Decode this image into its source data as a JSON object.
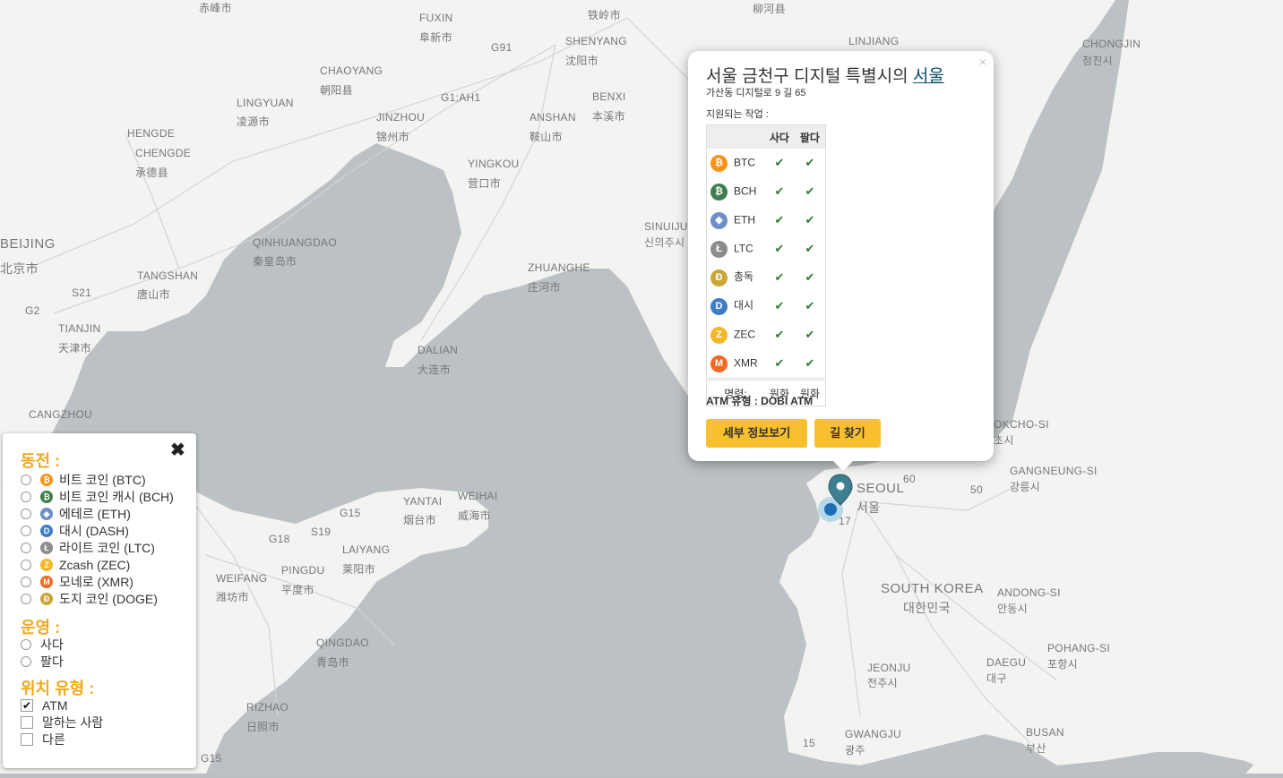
{
  "map": {
    "labels": [
      {
        "text": "赤峰市"
      },
      {
        "text": "FUXIN"
      },
      {
        "text": "阜新市"
      },
      {
        "text": "铁岭市"
      },
      {
        "text": "柳河县"
      },
      {
        "text": "G91"
      },
      {
        "text": "SHENYANG"
      },
      {
        "text": "沈阳市"
      },
      {
        "text": "LINJIANG"
      },
      {
        "text": "CHONGJIN"
      },
      {
        "text": "청진시"
      },
      {
        "text": "CHAOYANG"
      },
      {
        "text": "朝阳县"
      },
      {
        "text": "G1;AH1"
      },
      {
        "text": "BENXI"
      },
      {
        "text": "本溪市"
      },
      {
        "text": "LINGYUAN"
      },
      {
        "text": "凌源市"
      },
      {
        "text": "JINZHOU"
      },
      {
        "text": "锦州市"
      },
      {
        "text": "ANSHAN"
      },
      {
        "text": "鞍山市"
      },
      {
        "text": "HENGDE"
      },
      {
        "text": "CHENGDE"
      },
      {
        "text": "承德县"
      },
      {
        "text": "YINGKOU"
      },
      {
        "text": "营口市"
      },
      {
        "text": "SINUIJU"
      },
      {
        "text": "신의주시"
      },
      {
        "text": "BEIJING"
      },
      {
        "text": "北京市"
      },
      {
        "text": "QINHUANGDAO"
      },
      {
        "text": "秦皇岛市"
      },
      {
        "text": "ZHUANGHE"
      },
      {
        "text": "庄河市"
      },
      {
        "text": "TANGSHAN"
      },
      {
        "text": "唐山市"
      },
      {
        "text": "S21"
      },
      {
        "text": "G2"
      },
      {
        "text": "TIANJIN"
      },
      {
        "text": "天津市"
      },
      {
        "text": "DALIAN"
      },
      {
        "text": "大连市"
      },
      {
        "text": "CANGZHOU"
      },
      {
        "text": "YANTAI"
      },
      {
        "text": "烟台市"
      },
      {
        "text": "WEIHAI"
      },
      {
        "text": "威海市"
      },
      {
        "text": "G15"
      },
      {
        "text": "S19"
      },
      {
        "text": "G18"
      },
      {
        "text": "LAIYANG"
      },
      {
        "text": "莱阳市"
      },
      {
        "text": "PINGDU"
      },
      {
        "text": "平度市"
      },
      {
        "text": "WEIFANG"
      },
      {
        "text": "潍坊市"
      },
      {
        "text": "QINGDAO"
      },
      {
        "text": "青岛市"
      },
      {
        "text": "RIZHAO"
      },
      {
        "text": "日照市"
      },
      {
        "text": "G15"
      },
      {
        "text": "SEOUL"
      },
      {
        "text": "서울"
      },
      {
        "text": "60"
      },
      {
        "text": "50"
      },
      {
        "text": "17"
      },
      {
        "text": "SOUTH KOREA"
      },
      {
        "text": "대한민국"
      },
      {
        "text": "GANGNEUNG-SI"
      },
      {
        "text": "강릉시"
      },
      {
        "text": "OKCHO-SI"
      },
      {
        "text": "초시"
      },
      {
        "text": "ANDONG-SI"
      },
      {
        "text": "안동시"
      },
      {
        "text": "POHANG-SI"
      },
      {
        "text": "포항시"
      },
      {
        "text": "DAEGU"
      },
      {
        "text": "대구"
      },
      {
        "text": "JEONJU"
      },
      {
        "text": "전주시"
      },
      {
        "text": "BUSAN"
      },
      {
        "text": "부산"
      },
      {
        "text": "GWANGJU"
      },
      {
        "text": "광주"
      },
      {
        "text": "15"
      }
    ]
  },
  "popup": {
    "close": "×",
    "title_prefix": "서울 금천구 디지털 특별시의 ",
    "title_link": "서울",
    "address": "가산동 디지털로 9 길 65",
    "supported_label": "지원되는 작업 :",
    "col_buy": "사다",
    "col_sell": "팔다",
    "rows": [
      {
        "name": "BTC",
        "symbol": "₿",
        "color": "#f7931a",
        "buy": "✔",
        "sell": "✔"
      },
      {
        "name": "BCH",
        "symbol": "₿",
        "color": "#3f7d4c",
        "buy": "✔",
        "sell": "✔"
      },
      {
        "name": "ETH",
        "symbol": "◆",
        "color": "#6c8fc8",
        "buy": "✔",
        "sell": "✔"
      },
      {
        "name": "LTC",
        "symbol": "Ł",
        "color": "#8c8c8c",
        "buy": "✔",
        "sell": "✔"
      },
      {
        "name": "총독",
        "symbol": "Đ",
        "color": "#c9a636",
        "buy": "✔",
        "sell": "✔"
      },
      {
        "name": "대시",
        "symbol": "D",
        "color": "#3e7ec7",
        "buy": "✔",
        "sell": "✔"
      },
      {
        "name": "ZEC",
        "symbol": "Z",
        "color": "#f4b728",
        "buy": "✔",
        "sell": "✔"
      },
      {
        "name": "XMR",
        "symbol": "M",
        "color": "#f26822",
        "buy": "✔",
        "sell": "✔"
      }
    ],
    "footer_label": "명령:",
    "footer_buy": "원화",
    "footer_sell": "원화",
    "atm_type": "ATM 유형 : DOBI ATM",
    "details_button": "세부 정보보기",
    "directions_button": "길 찾기"
  },
  "filter": {
    "close": "✖",
    "coins_heading": "동전 :",
    "coins": [
      {
        "label": "비트 코인 (BTC)",
        "symbol": "₿",
        "color": "#f7931a"
      },
      {
        "label": "비트 코인 캐시 (BCH)",
        "symbol": "₿",
        "color": "#3f7d4c"
      },
      {
        "label": "에테르 (ETH)",
        "symbol": "◆",
        "color": "#6c8fc8"
      },
      {
        "label": "대시 (DASH)",
        "symbol": "D",
        "color": "#3e7ec7"
      },
      {
        "label": "라이트 코인 (LTC)",
        "symbol": "Ł",
        "color": "#8c8c8c"
      },
      {
        "label": "Zcash (ZEC)",
        "symbol": "Z",
        "color": "#f4b728"
      },
      {
        "label": "모네로 (XMR)",
        "symbol": "M",
        "color": "#f26822"
      },
      {
        "label": "도지 코인 (DOGE)",
        "symbol": "Đ",
        "color": "#c9a636"
      }
    ],
    "ops_heading": "운영 :",
    "ops": [
      {
        "label": "사다"
      },
      {
        "label": "팔다"
      }
    ],
    "loc_heading": "위치 유형 :",
    "locs": [
      {
        "label": "ATM",
        "checked": true
      },
      {
        "label": "말하는 사람",
        "checked": false
      },
      {
        "label": "다른",
        "checked": false
      }
    ],
    "check_mark": "✔"
  }
}
